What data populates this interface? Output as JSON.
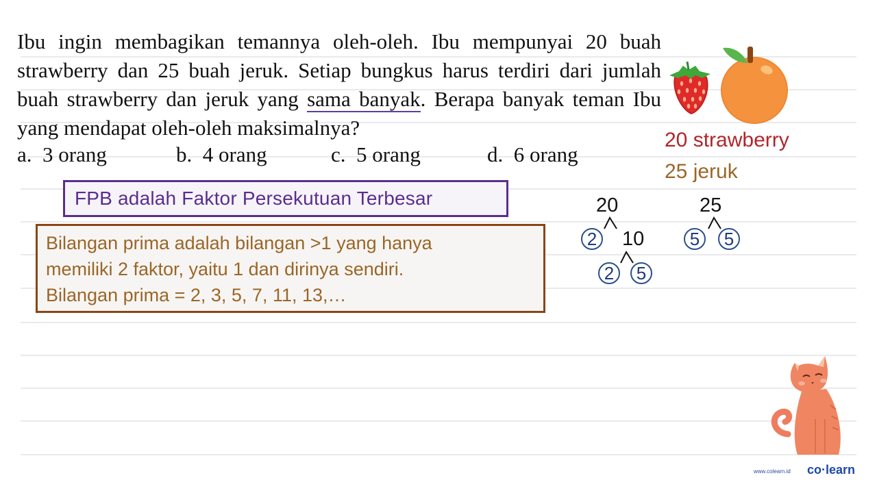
{
  "question": {
    "part1": "Ibu ingin membagikan temannya oleh-oleh. Ibu mempunyai 20 buah strawberry dan 25 buah jeruk. Setiap bungkus harus terdiri dari jumlah buah strawberry dan jeruk yang ",
    "underlined": "sama banyak",
    "part2": ". Berapa banyak teman Ibu yang mendapat oleh-oleh maksimalnya?"
  },
  "options": [
    {
      "letter": "a.",
      "text": "3 orang"
    },
    {
      "letter": "b.",
      "text": "4 orang"
    },
    {
      "letter": "c.",
      "text": "5 orang"
    },
    {
      "letter": "d.",
      "text": "6 orang"
    }
  ],
  "fpb_note": "FPB adalah Faktor Persekutuan Terbesar",
  "prima_note": {
    "line1": "Bilangan prima adalah bilangan >1 yang hanya",
    "line2": "memiliki 2 faktor, yaitu 1 dan dirinya sendiri.",
    "line3": "Bilangan prima = 2, 3, 5, 7, 11, 13,…"
  },
  "fruits": {
    "strawberry_label": "20 strawberry",
    "jeruk_label": "25 jeruk"
  },
  "factor_trees": {
    "tree20": {
      "root": "20",
      "prime1": "2",
      "mid": "10",
      "prime2": "2",
      "prime3": "5"
    },
    "tree25": {
      "root": "25",
      "prime1": "5",
      "prime2": "5"
    }
  },
  "branding": {
    "url": "www.colearn.id",
    "logo": "co·learn"
  },
  "colors": {
    "fpb_border": "#5b2d8e",
    "prima_border": "#8b4513",
    "strawberry_text": "#b0262b",
    "jeruk_text": "#9a6628",
    "circle_blue": "#2a4f8f",
    "logo_blue": "#1f47a8"
  }
}
